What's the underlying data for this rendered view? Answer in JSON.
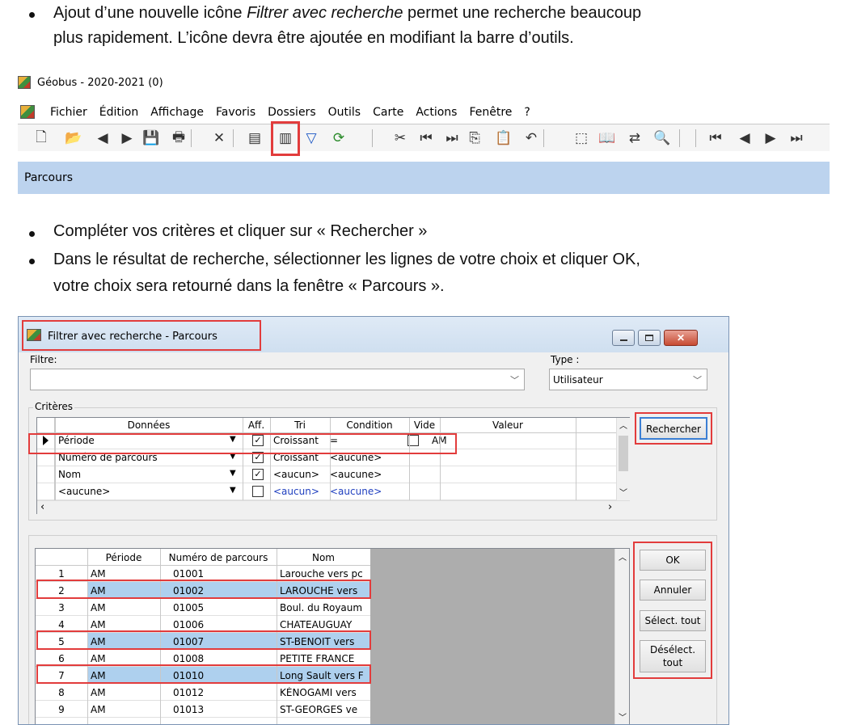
{
  "doc": {
    "bullet1_line1_a": "Ajout d’une nouvelle icône ",
    "bullet1_line1_em": "Filtrer avec recherche",
    "bullet1_line1_b": " permet une recherche beaucoup",
    "bullet1_line2": "plus rapidement. L’icône devra être ajoutée en modifiant la barre d’outils.",
    "bullet2": "Compléter vos critères et cliquer sur « Rechercher »",
    "bullet3_line1": "Dans le résultat de recherche, sélectionner les lignes de votre choix et cliquer OK,",
    "bullet3_line2": "votre choix sera retourné dans la fenêtre « Parcours »."
  },
  "app": {
    "title": "Géobus - 2020-2021 (0)",
    "menu": [
      "Fichier",
      "Édition",
      "Affichage",
      "Favoris",
      "Dossiers",
      "Outils",
      "Carte",
      "Actions",
      "Fenêtre",
      "?"
    ],
    "tab_label": "Parcours",
    "toolbar_icons": [
      "new-icon",
      "open-folder-icon",
      "previous-icon",
      "next-icon",
      "save-icon",
      "print-icon",
      "delete-icon",
      "filter-list-icon",
      "filter-search-icon",
      "filter-icon",
      "refresh-icon",
      "cut-icon",
      "first-icon",
      "last-icon",
      "copy-icon",
      "paste-icon",
      "undo-icon",
      "select-area-icon",
      "book-icon",
      "replace-icon",
      "zoom-icon",
      "first-record-icon",
      "previous-record-icon",
      "next-record-icon",
      "last-record-icon"
    ]
  },
  "dialog": {
    "title": "Filtrer avec recherche - Parcours",
    "filter_label": "Filtre:",
    "filter_value": "",
    "type_label": "Type :",
    "type_value": "Utilisateur",
    "criteria_label": "Critères",
    "criteria_columns": [
      "Données",
      "Aff.",
      "Tri",
      "Condition",
      "Vide",
      "Valeur"
    ],
    "criteria_rows": [
      {
        "donnees": "Période",
        "aff": true,
        "tri": "Croissant",
        "condition": "=",
        "vide": false,
        "valeur": "AM"
      },
      {
        "donnees": "Numéro de parcours",
        "aff": true,
        "tri": "Croissant",
        "condition": "<aucune>",
        "vide": null,
        "valeur": ""
      },
      {
        "donnees": "Nom",
        "aff": true,
        "tri": "<aucun>",
        "condition": "<aucune>",
        "vide": null,
        "valeur": ""
      },
      {
        "donnees": "<aucune>",
        "aff": false,
        "tri": "<aucun>",
        "condition": "<aucune>",
        "vide": null,
        "valeur": ""
      }
    ],
    "search_button": "Rechercher",
    "results_columns": [
      "Période",
      "Numéro de parcours",
      "Nom"
    ],
    "results_rows": [
      {
        "n": "1",
        "periode": "AM",
        "numero": "01001",
        "nom": "Larouche vers pc",
        "selected": false
      },
      {
        "n": "2",
        "periode": "AM",
        "numero": "01002",
        "nom": "LAROUCHE vers",
        "selected": true
      },
      {
        "n": "3",
        "periode": "AM",
        "numero": "01005",
        "nom": "Boul. du Royaum",
        "selected": false
      },
      {
        "n": "4",
        "periode": "AM",
        "numero": "01006",
        "nom": "CHATEAUGUAY",
        "selected": false
      },
      {
        "n": "5",
        "periode": "AM",
        "numero": "01007",
        "nom": "ST-BENOIT vers",
        "selected": true
      },
      {
        "n": "6",
        "periode": "AM",
        "numero": "01008",
        "nom": "PETITE FRANCE",
        "selected": false
      },
      {
        "n": "7",
        "periode": "AM",
        "numero": "01010",
        "nom": "Long Sault vers F",
        "selected": true
      },
      {
        "n": "8",
        "periode": "AM",
        "numero": "01012",
        "nom": "KÉNOGAMI vers",
        "selected": false
      },
      {
        "n": "9",
        "periode": "AM",
        "numero": "01013",
        "nom": "ST-GEORGES ve",
        "selected": false
      }
    ],
    "buttons": {
      "ok": "OK",
      "cancel": "Annuler",
      "select_all": "Sélect. tout",
      "deselect_line1": "Désélect.",
      "deselect_line2": "tout"
    }
  },
  "colors": {
    "highlight_box": "#e23c3c",
    "selection": "#aed0ee",
    "tab_bar": "#bcd3ee"
  }
}
